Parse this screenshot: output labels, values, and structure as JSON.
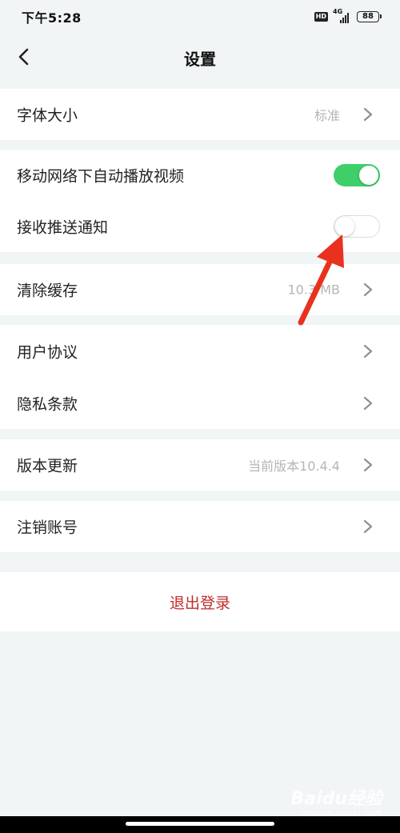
{
  "status_bar": {
    "time": "下午5:28",
    "hd": "HD",
    "network": "4G",
    "battery": "88"
  },
  "header": {
    "title": "设置",
    "back_icon": "chevron-left-icon"
  },
  "settings": {
    "font_size": {
      "label": "字体大小",
      "value": "标准"
    },
    "autoplay_video": {
      "label": "移动网络下自动播放视频",
      "enabled": true
    },
    "push_notifications": {
      "label": "接收推送通知",
      "enabled": false
    },
    "clear_cache": {
      "label": "清除缓存",
      "value": "10.3 MB"
    },
    "user_agreement": {
      "label": "用户协议"
    },
    "privacy_policy": {
      "label": "隐私条款"
    },
    "version_update": {
      "label": "版本更新",
      "value": "当前版本10.4.4"
    },
    "delete_account": {
      "label": "注销账号"
    }
  },
  "logout": {
    "label": "退出登录"
  },
  "colors": {
    "background": "#f1f5f6",
    "toggle_on": "#3ecf6a",
    "logout_text": "#c22b2b",
    "annotation_arrow": "#e8321e"
  },
  "watermark": {
    "logo": "Baidu经验",
    "url": "jingyan.baidu.com"
  }
}
